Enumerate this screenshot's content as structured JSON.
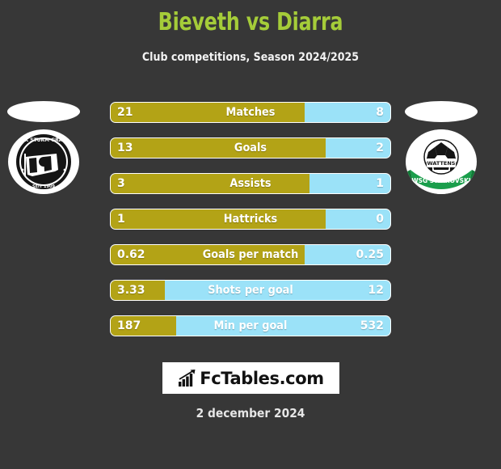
{
  "header": {
    "title": "Bieveth vs Diarra",
    "subtitle": "Club competitions, Season 2024/2025",
    "title_color": "#a5cc39"
  },
  "teams": {
    "home": {
      "badge_icon": "sk-sturm-graz-crest",
      "badge_text_top": "SK STURM GRAZ",
      "badge_text_bottom": "SEIT 1909"
    },
    "away": {
      "badge_icon": "wsg-swarovski-wattens-crest",
      "badge_text_center": "WATTENS",
      "badge_text_banner": "WSG SWAROVSKI"
    }
  },
  "colors": {
    "home_bar": "#b3a316",
    "away_bar": "#9be2f8",
    "background": "#373737",
    "bar_text": "#ffffff"
  },
  "chart_data": {
    "type": "bar",
    "title": "Bieveth vs Diarra",
    "subtitle": "Club competitions, Season 2024/2025",
    "orientation": "horizontal-diverging",
    "series": [
      {
        "name": "Bieveth",
        "color": "#b3a316",
        "values": [
          21,
          13,
          3,
          1,
          0.62,
          3.33,
          187
        ]
      },
      {
        "name": "Diarra",
        "color": "#9be2f8",
        "values": [
          8,
          2,
          1,
          0,
          0.25,
          12,
          532
        ]
      }
    ],
    "categories": [
      "Matches",
      "Goals",
      "Assists",
      "Hattricks",
      "Goals per match",
      "Shots per goal",
      "Min per goal"
    ],
    "rows": [
      {
        "label": "Matches",
        "home": "21",
        "away": "8",
        "home_pct": 69.3
      },
      {
        "label": "Goals",
        "home": "13",
        "away": "2",
        "home_pct": 77.0
      },
      {
        "label": "Assists",
        "home": "3",
        "away": "1",
        "home_pct": 71.0
      },
      {
        "label": "Hattricks",
        "home": "1",
        "away": "0",
        "home_pct": 77.0
      },
      {
        "label": "Goals per match",
        "home": "0.62",
        "away": "0.25",
        "home_pct": 69.3
      },
      {
        "label": "Shots per goal",
        "home": "3.33",
        "away": "12",
        "home_pct": 19.5
      },
      {
        "label": "Min per goal",
        "home": "187",
        "away": "532",
        "home_pct": 23.5
      }
    ],
    "grid": false,
    "legend": "none"
  },
  "footer": {
    "brand": "FcTables.com",
    "brand_icon": "bar-chart-growth-icon",
    "date": "2 december 2024"
  }
}
